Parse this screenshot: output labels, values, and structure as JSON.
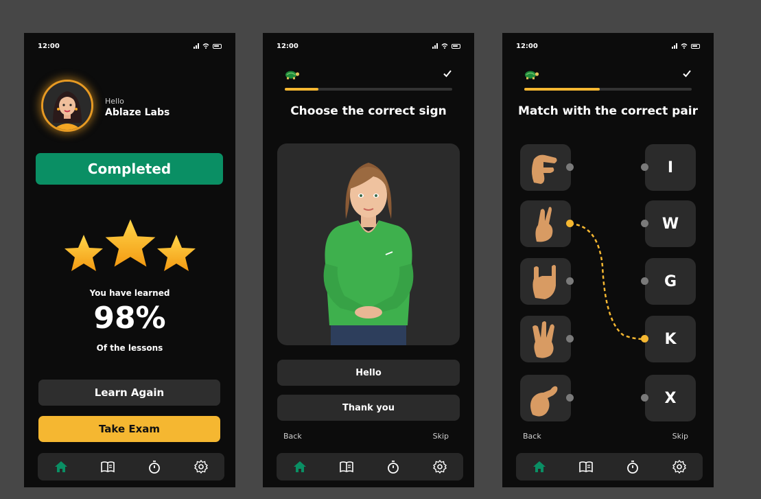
{
  "screens": [
    {
      "status_time": "12:00",
      "greeting": "Hello",
      "user_name": "Ablaze Labs",
      "status_label": "Completed",
      "stars": 3,
      "learned_label": "You have learned",
      "percent": "98%",
      "lessons_label": "Of the lessons",
      "learn_again": "Learn Again",
      "take_exam": "Take Exam"
    },
    {
      "status_time": "12:00",
      "progress": 0.2,
      "title": "Choose the correct sign",
      "answers": [
        "Hello",
        "Thank you"
      ],
      "back": "Back",
      "skip": "Skip"
    },
    {
      "status_time": "12:00",
      "progress": 0.45,
      "title": "Match with the correct pair",
      "letters": [
        "I",
        "W",
        "G",
        "K",
        "X"
      ],
      "back": "Back",
      "skip": "Skip"
    }
  ],
  "navbar": {
    "items": [
      "home-icon",
      "book-icon",
      "timer-icon",
      "settings-icon"
    ],
    "active": 0
  },
  "colors": {
    "accent_green": "#0a8f64",
    "accent_yellow": "#f5b731",
    "background": "#0c0c0c",
    "card": "#2b2b2b"
  }
}
